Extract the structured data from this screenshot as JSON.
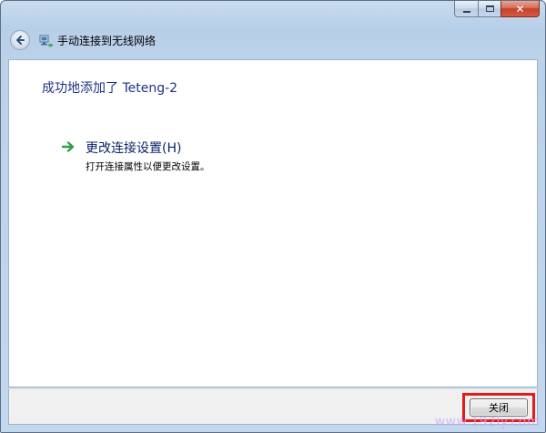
{
  "window": {
    "title": "手动连接到无线网络",
    "controls": {
      "minimize_icon": "minimize-icon",
      "maximize_icon": "maximize-icon",
      "close_icon": "close-icon",
      "close_glyph": "✕"
    }
  },
  "main": {
    "heading": "成功地添加了 Teteng-2",
    "link": {
      "icon": "green-arrow-icon",
      "title": "更改连接设置(H)",
      "description": "打开连接属性以便更改设置。"
    }
  },
  "footer": {
    "close_label": "关闭"
  },
  "watermark": "www.192ly.com",
  "colors": {
    "heading": "#1e3287",
    "link": "#0a246a",
    "highlight": "#e21b1b",
    "arrow": "#2ea043"
  }
}
